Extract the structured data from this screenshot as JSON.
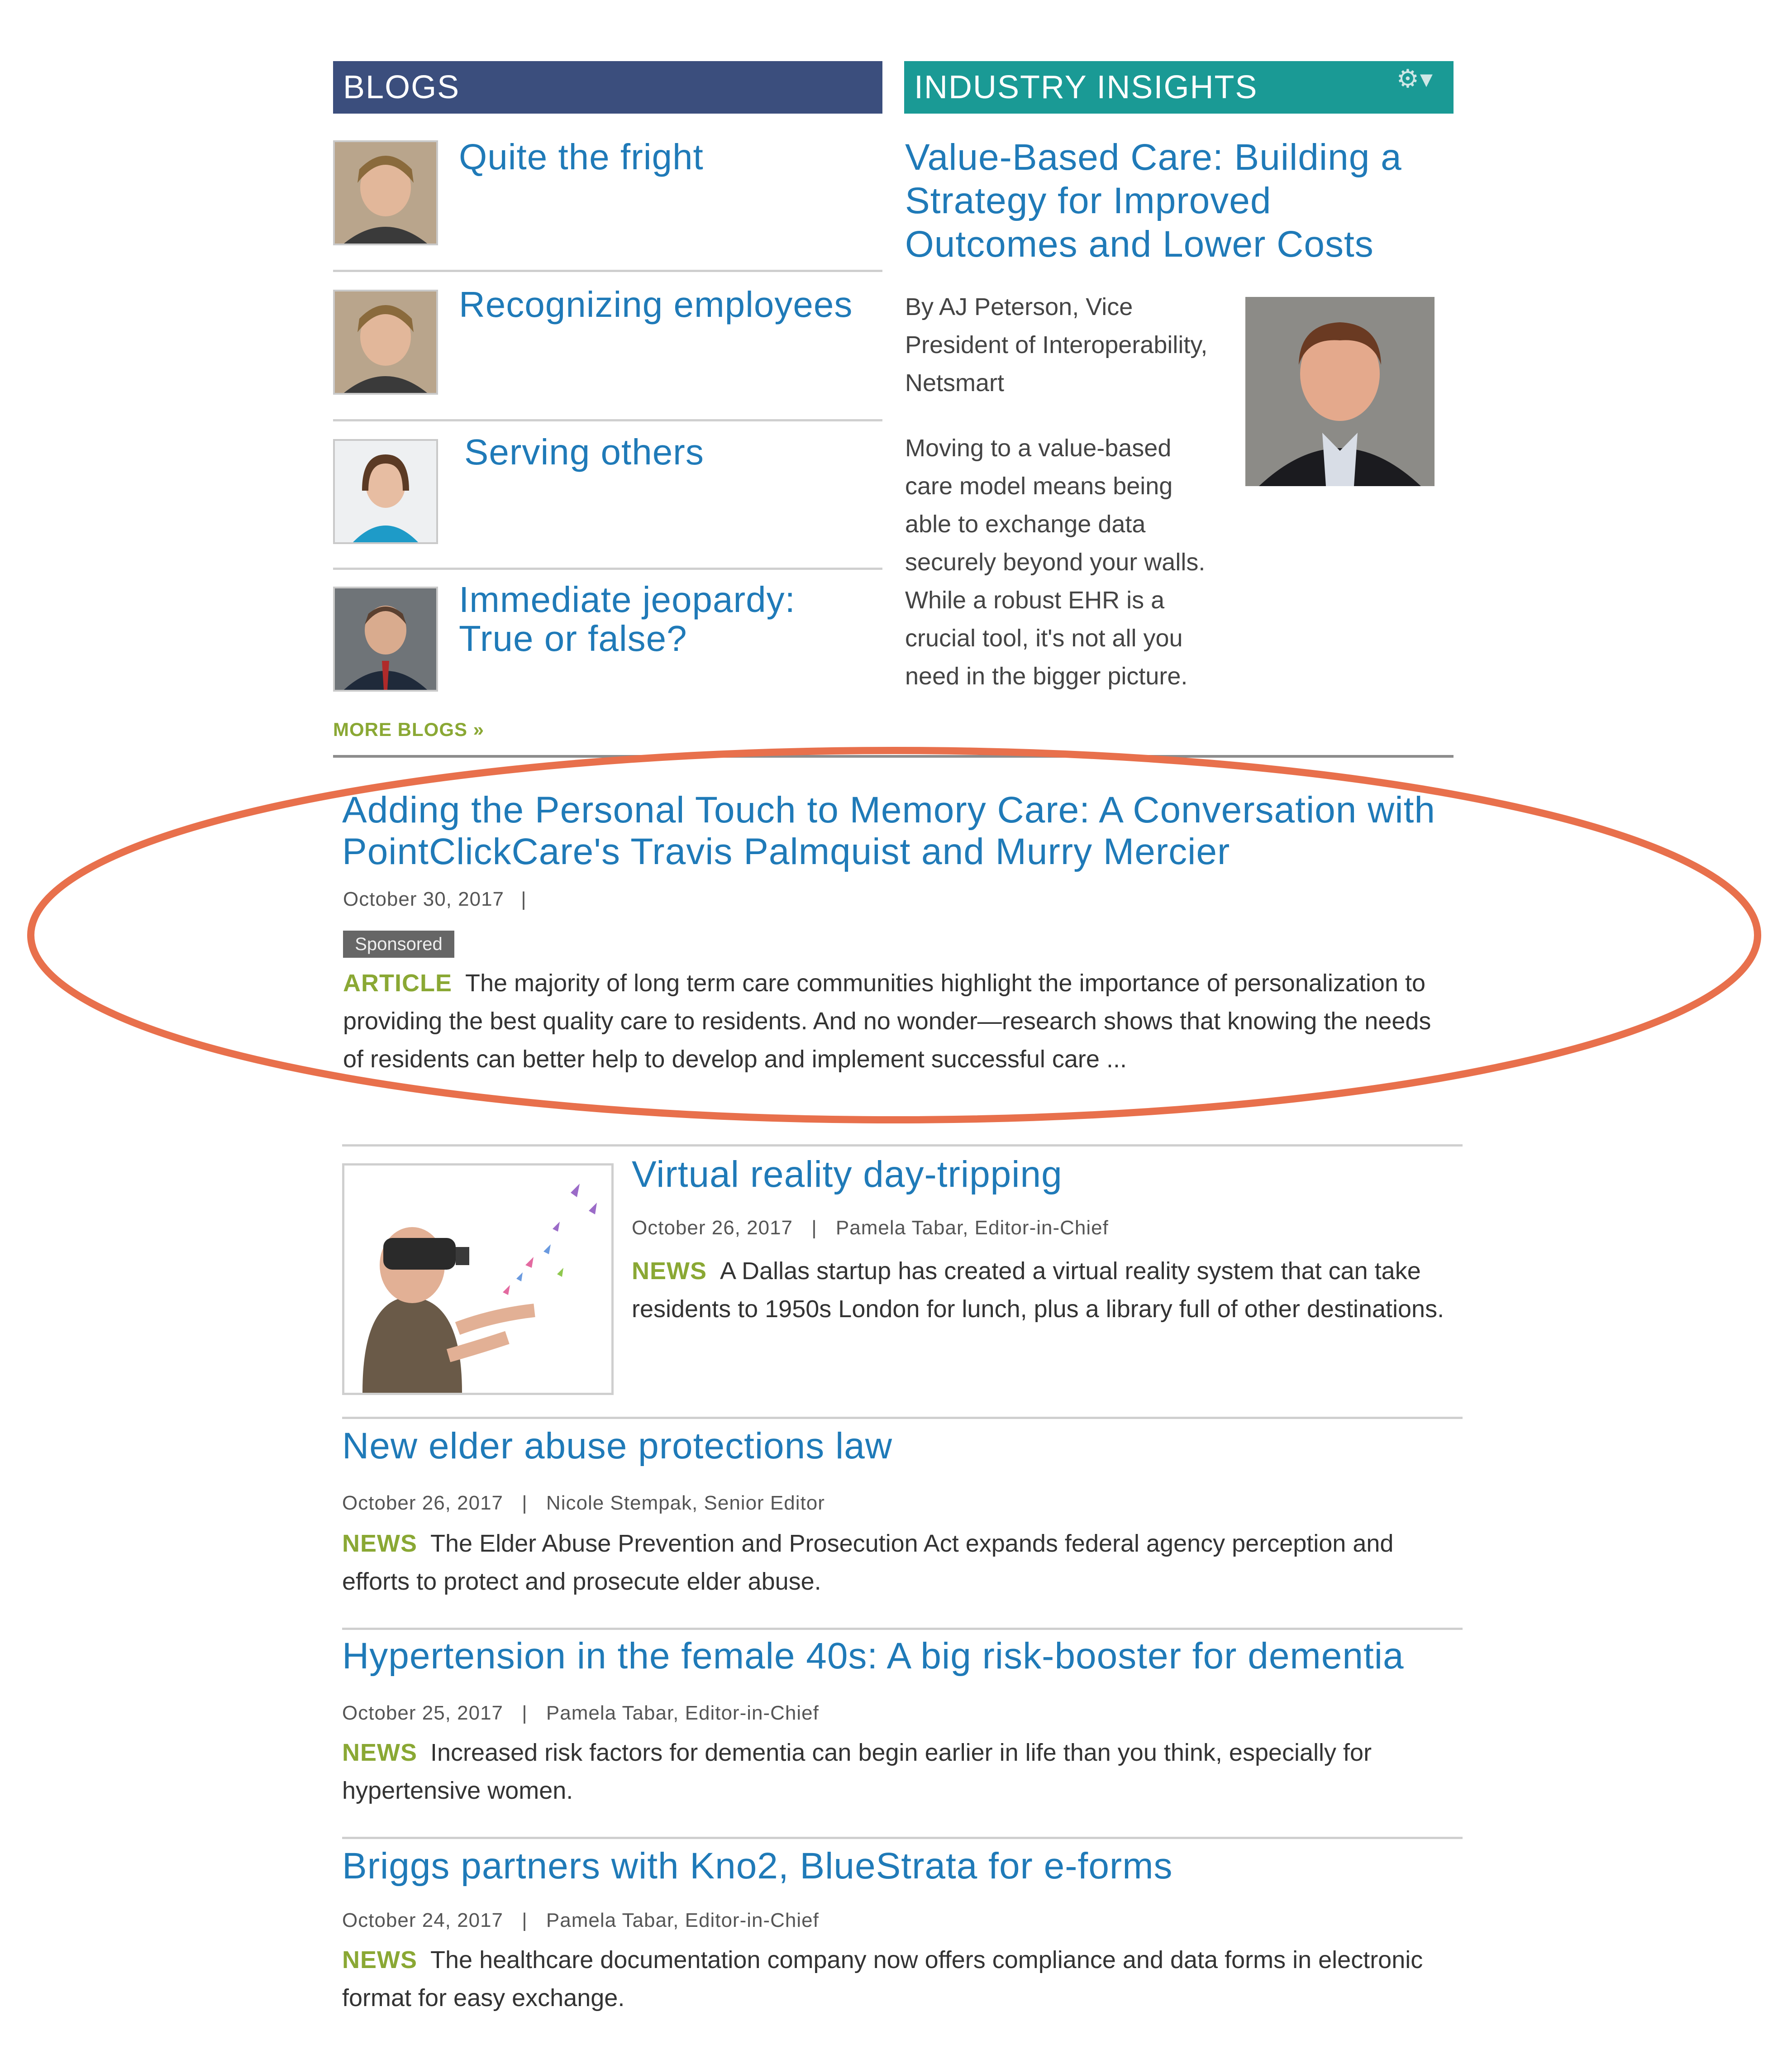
{
  "blogs": {
    "header": "BLOGS",
    "items": [
      {
        "title": "Quite the fright"
      },
      {
        "title": "Recognizing employees"
      },
      {
        "title": "Serving others"
      },
      {
        "title_line1": "Immediate jeopardy:",
        "title_line2": "True or false?"
      }
    ],
    "more_link": "MORE BLOGS »"
  },
  "insights": {
    "header": "INDUSTRY INSIGHTS",
    "settings_icon": "gear-icon",
    "title": "Value-Based Care: Building a Strategy for Improved Outcomes and Lower Costs",
    "byline": "By AJ Peterson, Vice President of Interoperability, Netsmart",
    "body": "Moving to a value-based care model means being able to exchange data securely beyond your walls. While a robust EHR is a crucial tool, it's not all you need in the bigger picture."
  },
  "featured": {
    "title": "Adding the Personal Touch to Memory Care: A Conversation with PointClickCare's Travis Palmquist and Murry Mercier",
    "date": "October 30, 2017",
    "meta_sep": "|",
    "badge": "Sponsored",
    "tag": "ARTICLE",
    "summary": "The majority of long term care communities highlight the importance of personalization to providing the best quality care to residents. And no wonder—research shows that knowing the needs of residents can better help to develop and implement successful care ..."
  },
  "articles": [
    {
      "title": "Virtual reality day-tripping",
      "date": "October 26, 2017",
      "author": "Pamela Tabar, Editor-in-Chief",
      "tag": "NEWS",
      "summary": "A Dallas startup has created a virtual reality system that can take residents to 1950s London for lunch, plus a library full of other destinations."
    },
    {
      "title": "New elder abuse protections law",
      "date": "October 26, 2017",
      "author": "Nicole Stempak, Senior Editor",
      "tag": "NEWS",
      "summary": "The Elder Abuse Prevention and Prosecution Act expands federal agency perception and efforts to protect and prosecute elder abuse."
    },
    {
      "title": "Hypertension in the female 40s: A big risk-booster for dementia",
      "date": "October 25, 2017",
      "author": "Pamela Tabar, Editor-in-Chief",
      "tag": "NEWS",
      "summary": "Increased risk factors for dementia can begin earlier in life than you think, especially for hypertensive women."
    },
    {
      "title": "Briggs partners with Kno2, BlueStrata for e-forms",
      "date": "October 24, 2017",
      "author": "Pamela Tabar, Editor-in-Chief",
      "tag": "NEWS",
      "summary": "The healthcare documentation company now offers compliance and data forms in electronic format for easy exchange."
    }
  ],
  "colors": {
    "blogs_header": "#3b4e7d",
    "insights_header": "#1a9a95",
    "link_blue": "#1f7ab8",
    "tag_green": "#8aa834",
    "annotation_oval": "#e8704c"
  }
}
